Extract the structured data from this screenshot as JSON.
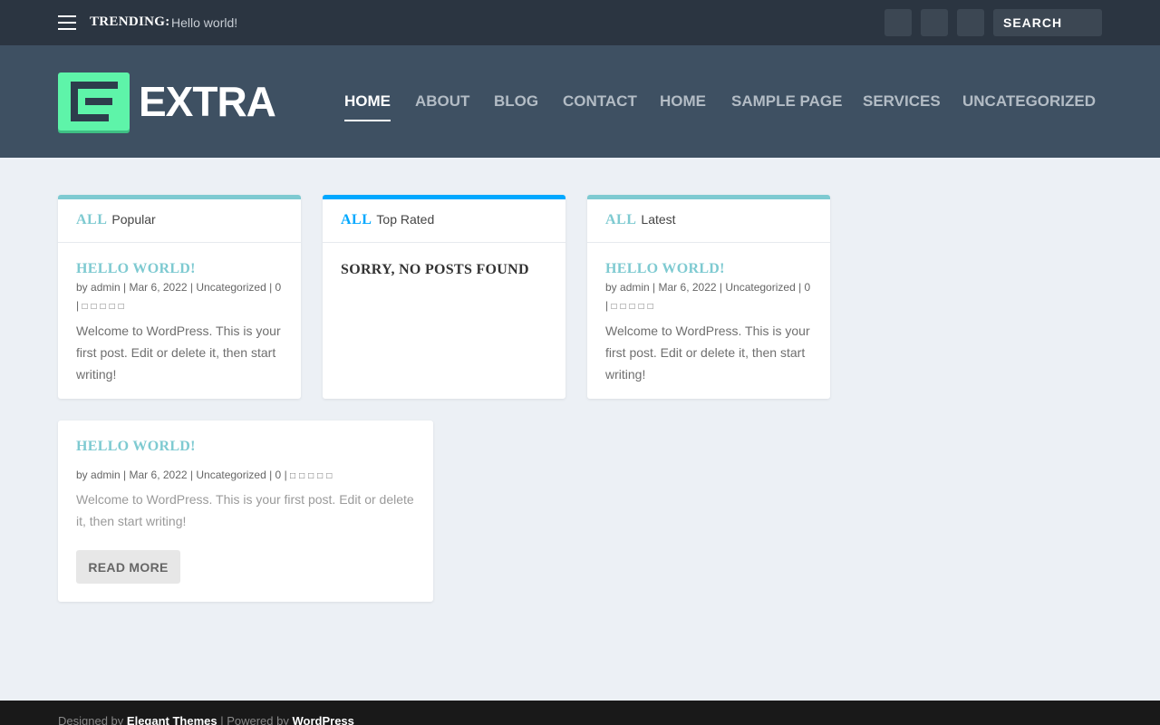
{
  "topbar": {
    "trending_label": "TRENDING:",
    "trending_link": "Hello world!",
    "social_icons": [
      "",
      "",
      ""
    ],
    "search_placeholder": "SEARCH",
    "search_icon": ""
  },
  "header": {
    "logo_text": "EXTRA",
    "nav": [
      "HOME",
      "ABOUT",
      "BLOG",
      "CONTACT",
      "HOME",
      "SAMPLE PAGE",
      "SERVICES",
      "UNCATEGORIZED"
    ],
    "active_index": 0
  },
  "cards": {
    "popular": {
      "all": "ALL",
      "label": "Popular",
      "accent": "#7ecad1",
      "post": {
        "title": "HELLO WORLD!",
        "meta_by": "by",
        "meta_author": "admin",
        "meta_date": "Mar 6, 2022",
        "meta_category": "Uncategorized",
        "meta_comments": "0",
        "meta_icons": " | ",
        "excerpt": "Welcome to WordPress. This is your first post. Edit or delete it, then start writing!"
      }
    },
    "top_rated": {
      "all": "ALL",
      "label": "Top Rated",
      "accent": "#00a8ff",
      "empty": "SORRY, NO POSTS FOUND"
    },
    "latest": {
      "all": "ALL",
      "label": "Latest",
      "accent": "#7ecad1",
      "post": {
        "title": "HELLO WORLD!",
        "meta_by": "by",
        "meta_author": "admin",
        "meta_date": "Mar 6, 2022",
        "meta_category": "Uncategorized",
        "meta_comments": "0",
        "meta_icons": " | ",
        "excerpt": "Welcome to WordPress. This is your first post. Edit or delete it, then start writing!"
      }
    },
    "feature": {
      "title": "HELLO WORLD!",
      "meta_by": "by",
      "meta_author": "admin",
      "meta_date": "Mar 6, 2022",
      "meta_category": "Uncategorized",
      "meta_comments": "0",
      "meta_icons": " | ",
      "excerpt": "Welcome to WordPress. This is your first post. Edit or delete it, then start writing!",
      "read_more": "READ MORE"
    }
  },
  "footer": {
    "designed_by": "Designed by",
    "elegant": "Elegant Themes",
    "powered_by": " | Powered by ",
    "wordpress": "WordPress",
    "icons": [
      "",
      "",
      ""
    ]
  }
}
